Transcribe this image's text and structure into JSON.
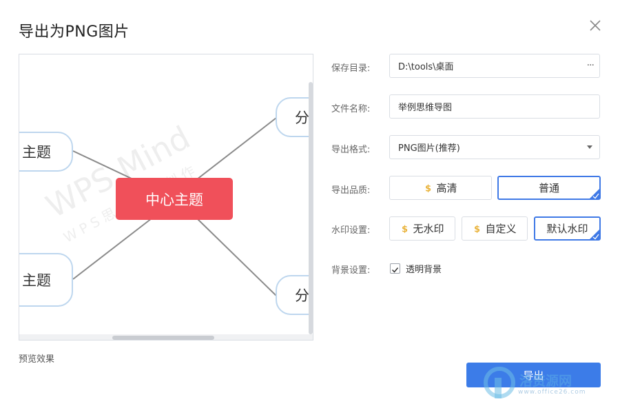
{
  "dialog": {
    "title": "导出为PNG图片"
  },
  "preview": {
    "center_topic": "中心主题",
    "branch_left_top": "主题",
    "branch_left_bottom": "主题",
    "branch_left_bottom_extra": "",
    "branch_right_top": "分",
    "branch_right_bottom": "分",
    "watermark_line1": "WPS Mind",
    "watermark_line2": "WPS思维导图制作",
    "label": "预览效果"
  },
  "form": {
    "save_dir_label": "保存目录:",
    "save_dir_value": "D:\\tools\\桌面",
    "save_dir_more": "···",
    "file_name_label": "文件名称:",
    "file_name_value": "举例思维导图",
    "format_label": "导出格式:",
    "format_value": "PNG图片(推荐)",
    "quality_label": "导出品质:",
    "quality_options": [
      "高清",
      "普通"
    ],
    "quality_selected": "普通",
    "watermark_label": "水印设置:",
    "watermark_options": [
      "无水印",
      "自定义",
      "默认水印"
    ],
    "watermark_selected": "默认水印",
    "background_label": "背景设置:",
    "transparent_bg_label": "透明背景",
    "transparent_bg_checked": true
  },
  "actions": {
    "export_label": "导出"
  },
  "site_watermark": {
    "text": "洛资源网",
    "url": "www.office26.com"
  },
  "colors": {
    "center_node": "#f0505a",
    "branch_border": "#bdd6ee",
    "primary": "#3c7ce8",
    "coin": "#e9b33b"
  }
}
